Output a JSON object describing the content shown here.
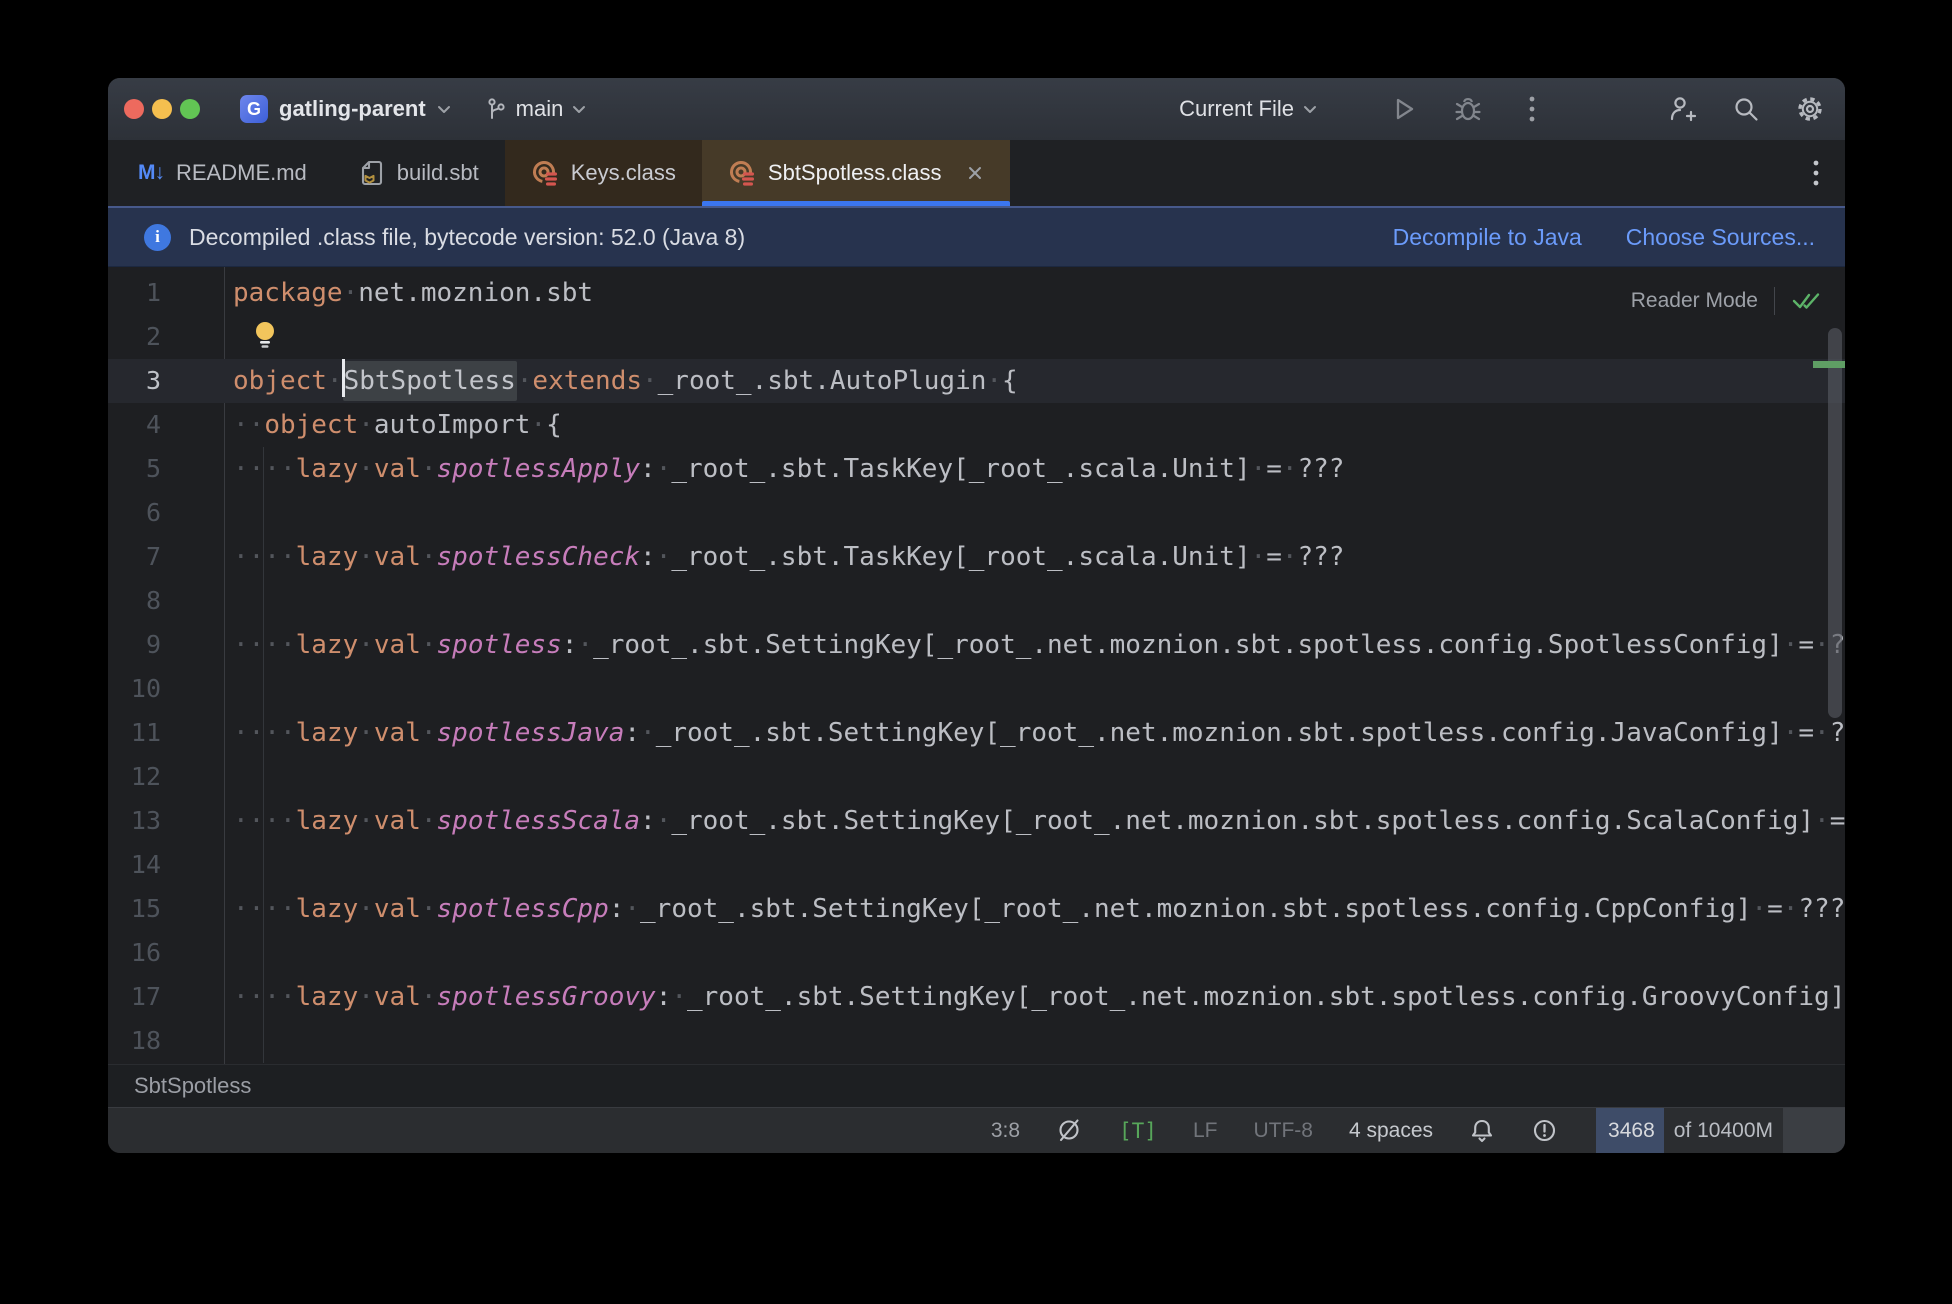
{
  "titlebar": {
    "project_icon_letter": "G",
    "project_name": "gatling-parent",
    "branch_name": "main",
    "run_config": "Current File",
    "icons": [
      "run-icon",
      "debug-icon",
      "more-icon",
      "add-user-icon",
      "search-icon",
      "settings-icon"
    ]
  },
  "tabbar": {
    "tabs": [
      {
        "label": "README.md",
        "icon": "markdown-icon"
      },
      {
        "label": "build.sbt",
        "icon": "sbt-file-icon"
      },
      {
        "label": "Keys.class",
        "icon": "decompiled-class-icon"
      },
      {
        "label": "SbtSpotless.class",
        "icon": "decompiled-class-icon",
        "active": true,
        "has_close": true
      }
    ],
    "markdown_glyph": "M↓"
  },
  "banner": {
    "message": "Decompiled .class file, bytecode version: 52.0 (Java 8)",
    "info_glyph": "i",
    "actions": [
      "Decompile to Java",
      "Choose Sources..."
    ]
  },
  "editor": {
    "reader_mode_label": "Reader Mode",
    "lines": [
      {
        "num": 1,
        "segments": [
          {
            "t": "package",
            "s": "kw"
          },
          {
            "t": "·",
            "s": "ws"
          },
          {
            "t": "net.moznion.sbt",
            "s": "pl"
          }
        ]
      },
      {
        "num": 2,
        "bulb": true,
        "segments": []
      },
      {
        "num": 3,
        "current": true,
        "segments": [
          {
            "t": "object",
            "s": "kw"
          },
          {
            "t": "·",
            "s": "ws"
          },
          {
            "t": "SbtSpotless",
            "s": "hl"
          },
          {
            "t": "·",
            "s": "ws"
          },
          {
            "t": "extends",
            "s": "kw"
          },
          {
            "t": "·",
            "s": "ws"
          },
          {
            "t": "_root_.sbt.AutoPlugin",
            "s": "pl"
          },
          {
            "t": "·",
            "s": "ws"
          },
          {
            "t": "{",
            "s": "pl"
          }
        ]
      },
      {
        "num": 4,
        "segments": [
          {
            "t": "··",
            "s": "ws"
          },
          {
            "t": "object",
            "s": "kw"
          },
          {
            "t": "·",
            "s": "ws"
          },
          {
            "t": "autoImport",
            "s": "pl"
          },
          {
            "t": "·",
            "s": "ws"
          },
          {
            "t": "{",
            "s": "pl"
          }
        ]
      },
      {
        "num": 5,
        "segments": [
          {
            "t": "····",
            "s": "ws"
          },
          {
            "t": "lazy",
            "s": "kw"
          },
          {
            "t": "·",
            "s": "ws"
          },
          {
            "t": "val",
            "s": "kw"
          },
          {
            "t": "·",
            "s": "ws"
          },
          {
            "t": "spotlessApply",
            "s": "fld"
          },
          {
            "t": ":",
            "s": "pl"
          },
          {
            "t": "·",
            "s": "ws"
          },
          {
            "t": "_root_.sbt.TaskKey[_root_.scala.Unit]",
            "s": "pl"
          },
          {
            "t": "·",
            "s": "ws"
          },
          {
            "t": "=",
            "s": "pl"
          },
          {
            "t": "·",
            "s": "ws"
          },
          {
            "t": "???",
            "s": "pl"
          }
        ]
      },
      {
        "num": 6,
        "segments": []
      },
      {
        "num": 7,
        "segments": [
          {
            "t": "····",
            "s": "ws"
          },
          {
            "t": "lazy",
            "s": "kw"
          },
          {
            "t": "·",
            "s": "ws"
          },
          {
            "t": "val",
            "s": "kw"
          },
          {
            "t": "·",
            "s": "ws"
          },
          {
            "t": "spotlessCheck",
            "s": "fld"
          },
          {
            "t": ":",
            "s": "pl"
          },
          {
            "t": "·",
            "s": "ws"
          },
          {
            "t": "_root_.sbt.TaskKey[_root_.scala.Unit]",
            "s": "pl"
          },
          {
            "t": "·",
            "s": "ws"
          },
          {
            "t": "=",
            "s": "pl"
          },
          {
            "t": "·",
            "s": "ws"
          },
          {
            "t": "???",
            "s": "pl"
          }
        ]
      },
      {
        "num": 8,
        "segments": []
      },
      {
        "num": 9,
        "segments": [
          {
            "t": "····",
            "s": "ws"
          },
          {
            "t": "lazy",
            "s": "kw"
          },
          {
            "t": "·",
            "s": "ws"
          },
          {
            "t": "val",
            "s": "kw"
          },
          {
            "t": "·",
            "s": "ws"
          },
          {
            "t": "spotless",
            "s": "fld"
          },
          {
            "t": ":",
            "s": "pl"
          },
          {
            "t": "·",
            "s": "ws"
          },
          {
            "t": "_root_.sbt.SettingKey[_root_.net.moznion.sbt.spotless.config.SpotlessConfig]",
            "s": "pl"
          },
          {
            "t": "·",
            "s": "ws"
          },
          {
            "t": "=",
            "s": "pl"
          },
          {
            "t": "·",
            "s": "ws"
          },
          {
            "t": "???",
            "s": "pl"
          }
        ]
      },
      {
        "num": 10,
        "segments": []
      },
      {
        "num": 11,
        "segments": [
          {
            "t": "····",
            "s": "ws"
          },
          {
            "t": "lazy",
            "s": "kw"
          },
          {
            "t": "·",
            "s": "ws"
          },
          {
            "t": "val",
            "s": "kw"
          },
          {
            "t": "·",
            "s": "ws"
          },
          {
            "t": "spotlessJava",
            "s": "fld"
          },
          {
            "t": ":",
            "s": "pl"
          },
          {
            "t": "·",
            "s": "ws"
          },
          {
            "t": "_root_.sbt.SettingKey[_root_.net.moznion.sbt.spotless.config.JavaConfig]",
            "s": "pl"
          },
          {
            "t": "·",
            "s": "ws"
          },
          {
            "t": "=",
            "s": "pl"
          },
          {
            "t": "·",
            "s": "ws"
          },
          {
            "t": "???",
            "s": "pl"
          }
        ]
      },
      {
        "num": 12,
        "segments": []
      },
      {
        "num": 13,
        "segments": [
          {
            "t": "····",
            "s": "ws"
          },
          {
            "t": "lazy",
            "s": "kw"
          },
          {
            "t": "·",
            "s": "ws"
          },
          {
            "t": "val",
            "s": "kw"
          },
          {
            "t": "·",
            "s": "ws"
          },
          {
            "t": "spotlessScala",
            "s": "fld"
          },
          {
            "t": ":",
            "s": "pl"
          },
          {
            "t": "·",
            "s": "ws"
          },
          {
            "t": "_root_.sbt.SettingKey[_root_.net.moznion.sbt.spotless.config.ScalaConfig]",
            "s": "pl"
          },
          {
            "t": "·",
            "s": "ws"
          },
          {
            "t": "=",
            "s": "pl"
          },
          {
            "t": "·",
            "s": "ws"
          },
          {
            "t": "???",
            "s": "pl"
          }
        ]
      },
      {
        "num": 14,
        "segments": []
      },
      {
        "num": 15,
        "segments": [
          {
            "t": "····",
            "s": "ws"
          },
          {
            "t": "lazy",
            "s": "kw"
          },
          {
            "t": "·",
            "s": "ws"
          },
          {
            "t": "val",
            "s": "kw"
          },
          {
            "t": "·",
            "s": "ws"
          },
          {
            "t": "spotlessCpp",
            "s": "fld"
          },
          {
            "t": ":",
            "s": "pl"
          },
          {
            "t": "·",
            "s": "ws"
          },
          {
            "t": "_root_.sbt.SettingKey[_root_.net.moznion.sbt.spotless.config.CppConfig]",
            "s": "pl"
          },
          {
            "t": "·",
            "s": "ws"
          },
          {
            "t": "=",
            "s": "pl"
          },
          {
            "t": "·",
            "s": "ws"
          },
          {
            "t": "???",
            "s": "pl"
          }
        ]
      },
      {
        "num": 16,
        "segments": []
      },
      {
        "num": 17,
        "segments": [
          {
            "t": "····",
            "s": "ws"
          },
          {
            "t": "lazy",
            "s": "kw"
          },
          {
            "t": "·",
            "s": "ws"
          },
          {
            "t": "val",
            "s": "kw"
          },
          {
            "t": "·",
            "s": "ws"
          },
          {
            "t": "spotlessGroovy",
            "s": "fld"
          },
          {
            "t": ":",
            "s": "pl"
          },
          {
            "t": "·",
            "s": "ws"
          },
          {
            "t": "_root_.sbt.SettingKey[_root_.net.moznion.sbt.spotless.config.GroovyConfig]",
            "s": "pl"
          },
          {
            "t": "·",
            "s": "ws"
          },
          {
            "t": "=",
            "s": "pl"
          },
          {
            "t": "·",
            "s": "ws"
          },
          {
            "t": "???",
            "s": "pl"
          }
        ]
      },
      {
        "num": 18,
        "segments": []
      }
    ]
  },
  "breadcrumb": {
    "text": "SbtSpotless"
  },
  "statusbar": {
    "caret_position": "3:8",
    "t_badge": "[T]",
    "line_ending": "LF",
    "encoding": "UTF-8",
    "indent": "4 spaces",
    "memory_used": "3468",
    "memory_rest": "of 10400M",
    "icons": [
      "highlighting-level-icon",
      "notifications-bell-icon",
      "warning-circle-icon"
    ]
  },
  "colors": {
    "accent_blue": "#3b76f0",
    "link_blue": "#6b9bfa",
    "keyword_orange": "#cf8e6d",
    "field_purple": "#c77dbb",
    "banner_bg": "#27334e",
    "tab_active_tint": "#463a28",
    "tab_inactive_tint": "#33291d",
    "memory_used_bg": "#3e4c68",
    "traffic_red": "#ed6a5e",
    "traffic_yellow": "#f5bf4f",
    "traffic_green": "#62c554"
  }
}
